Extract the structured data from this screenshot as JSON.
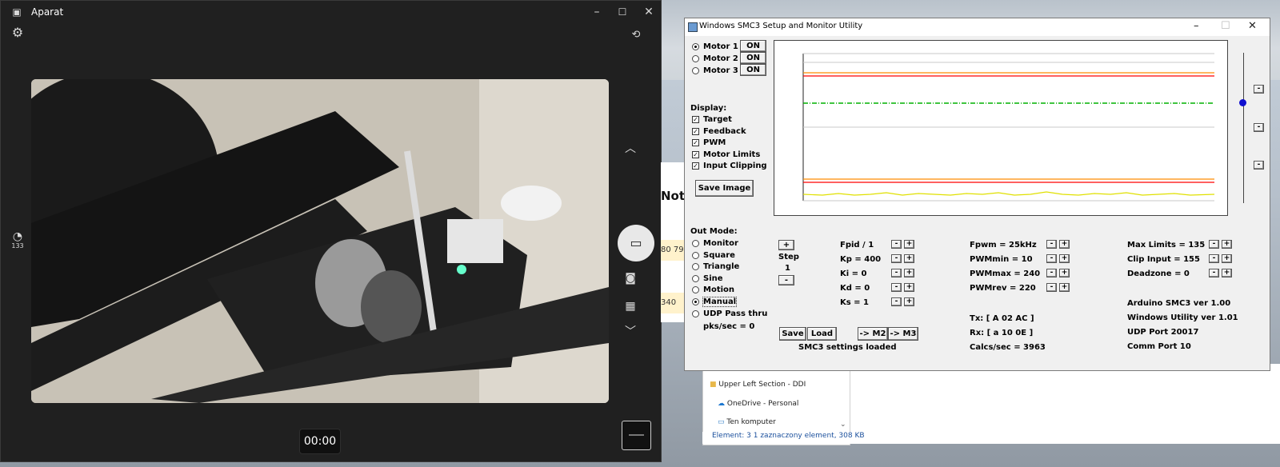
{
  "camera": {
    "title": "Aparat",
    "timer": "00:00",
    "badge": "133",
    "icons": {
      "settings": "gear-icon",
      "photo_settings": "camera-switch-icon",
      "video": "video-icon",
      "photo": "camera-icon",
      "qr": "qr-icon",
      "up": "chevron-up-icon",
      "down": "chevron-down-icon",
      "hdr": "hdr-icon"
    }
  },
  "notepad": {
    "title": "Note",
    "row1": "80 79",
    "row2": "340"
  },
  "explorer": {
    "items": [
      "Upper Left Section - DDI",
      "OneDrive - Personal",
      "Ten komputer"
    ],
    "status": "Element: 3     1 zaznaczony element, 308 KB"
  },
  "smc": {
    "title": "Windows SMC3 Setup and Monitor Utility",
    "motors": [
      {
        "label": "Motor 1",
        "state": "ON",
        "selected": true
      },
      {
        "label": "Motor 2",
        "state": "ON",
        "selected": false
      },
      {
        "label": "Motor 3",
        "state": "ON",
        "selected": false
      }
    ],
    "display_label": "Display:",
    "display": [
      "Target",
      "Feedback",
      "PWM",
      "Motor Limits",
      "Input Clipping"
    ],
    "save_image": "Save Image",
    "out_mode_label": "Out Mode:",
    "out_modes": [
      "Monitor",
      "Square",
      "Triangle",
      "Sine",
      "Motion",
      "Manual",
      "UDP Pass thru"
    ],
    "selected_mode": "Manual",
    "pks": "pks/sec = 0",
    "step_label": "Step",
    "step_value": "1",
    "plus": "+",
    "minus": "-",
    "pid": [
      "Fpid / 1",
      "Kp = 400",
      "Ki = 0",
      "Kd = 0",
      "Ks = 1"
    ],
    "pwm": [
      "Fpwm = 25kHz",
      "PWMmin = 10",
      "PWMmax = 240",
      "PWMrev = 220"
    ],
    "limits": [
      "Max Limits = 135",
      "Clip Input = 155",
      "Deadzone = 0"
    ],
    "info": [
      "Arduino SMC3 ver 1.00",
      "Windows Utility ver 1.01",
      "UDP Port 20017",
      "Comm Port 10"
    ],
    "tx": "Tx: [ A 02 AC ]",
    "rx": "Rx: [ a 10 0E ]",
    "calcs": "Calcs/sec = 3963",
    "save": "Save",
    "load": "Load",
    "to_m2": "-> M2",
    "to_m3": "-> M3",
    "status": "SMC3 settings loaded",
    "colors": {
      "target": "#ff0000",
      "limits": "#ff8c00",
      "feedback": "#00b000",
      "pwm": "#e0e000",
      "slider": "#1010d0"
    }
  }
}
